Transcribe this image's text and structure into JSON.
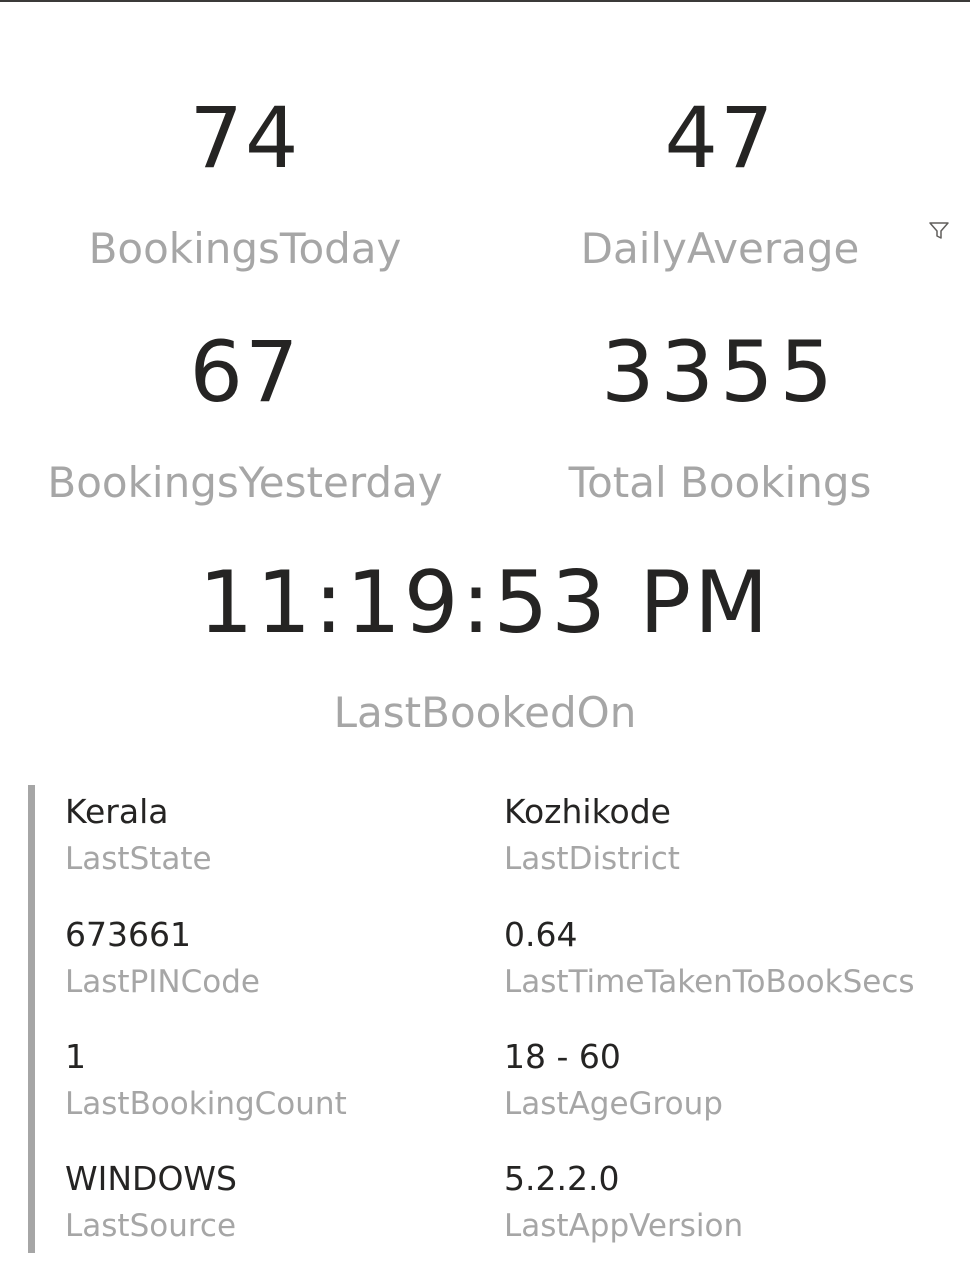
{
  "cards": {
    "bookings_today": {
      "value": "74",
      "label": "BookingsToday"
    },
    "daily_average": {
      "value": "47",
      "label": "DailyAverage"
    },
    "bookings_yesterday": {
      "value": "67",
      "label": "BookingsYesterday"
    },
    "total_bookings": {
      "value": "3355",
      "label": "Total Bookings"
    },
    "last_booked_on": {
      "value": "11:19:53 PM",
      "label": "LastBookedOn"
    }
  },
  "filter_icon": "filter-icon",
  "details": [
    {
      "value": "Kerala",
      "label": "LastState"
    },
    {
      "value": "Kozhikode",
      "label": "LastDistrict"
    },
    {
      "value": "673661",
      "label": "LastPINCode"
    },
    {
      "value": "0.64",
      "label": "LastTimeTakenToBookSecs"
    },
    {
      "value": "1",
      "label": "LastBookingCount"
    },
    {
      "value": "18 - 60",
      "label": "LastAgeGroup"
    },
    {
      "value": "WINDOWS",
      "label": "LastSource"
    },
    {
      "value": "5.2.2.0",
      "label": "LastAppVersion"
    }
  ],
  "colors": {
    "value_text": "#252423",
    "label_text": "#a6a6a6",
    "accent_bar": "#a6a6a6"
  }
}
